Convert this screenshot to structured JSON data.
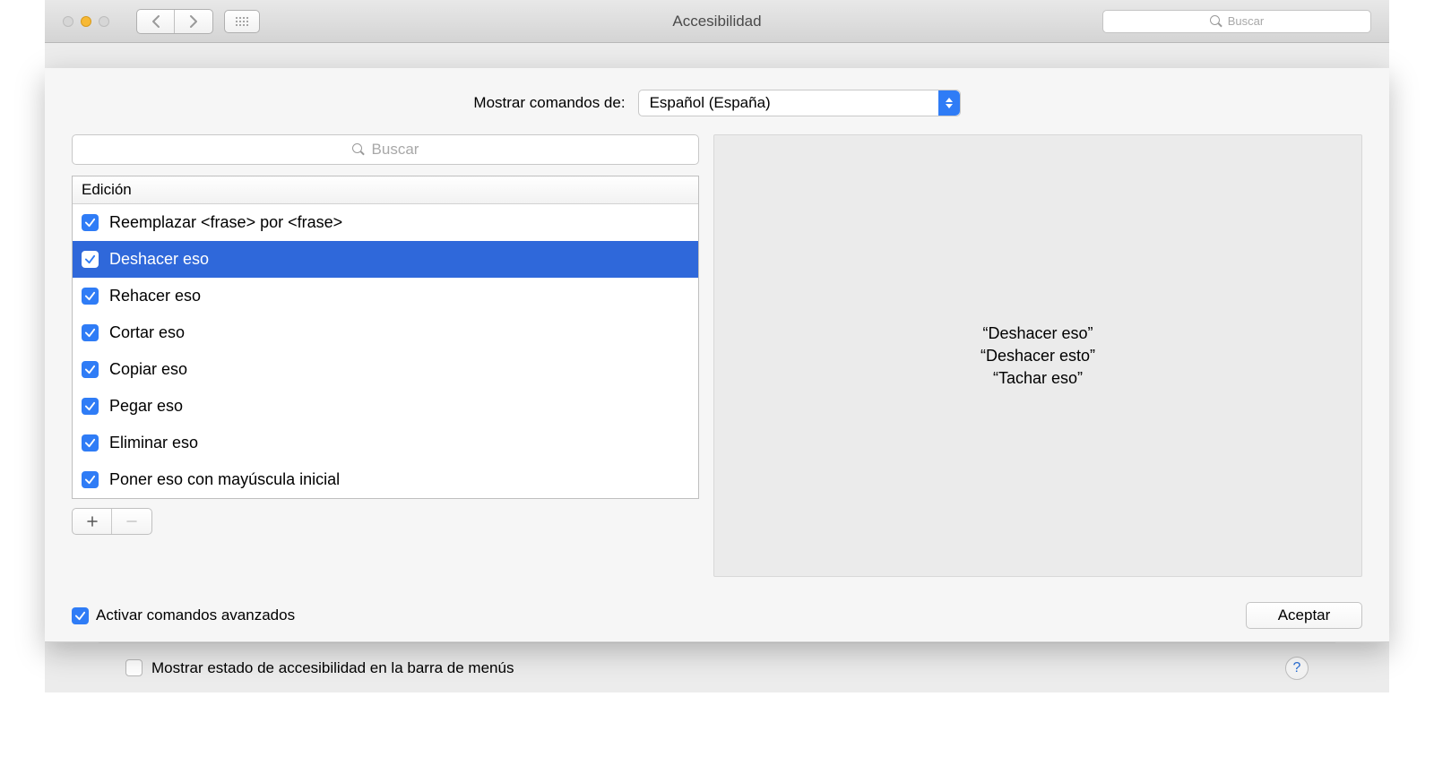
{
  "titlebar": {
    "title": "Accesibilidad",
    "search_placeholder": "Buscar"
  },
  "sheet": {
    "lang_label": "Mostrar comandos de:",
    "lang_value": "Español (España)",
    "search_placeholder": "Buscar",
    "list_header": "Edición",
    "items": [
      {
        "label": "Reemplazar <frase> por <frase>",
        "checked": true,
        "selected": false
      },
      {
        "label": "Deshacer eso",
        "checked": true,
        "selected": true
      },
      {
        "label": "Rehacer eso",
        "checked": true,
        "selected": false
      },
      {
        "label": "Cortar eso",
        "checked": true,
        "selected": false
      },
      {
        "label": "Copiar eso",
        "checked": true,
        "selected": false
      },
      {
        "label": "Pegar eso",
        "checked": true,
        "selected": false
      },
      {
        "label": "Eliminar eso",
        "checked": true,
        "selected": false
      },
      {
        "label": "Poner eso con mayúscula inicial",
        "checked": true,
        "selected": false
      }
    ],
    "detail": {
      "line1": "“Deshacer eso”",
      "line2": "“Deshacer esto”",
      "line3": "“Tachar eso”"
    },
    "advanced_label": "Activar comandos avanzados",
    "accept_label": "Aceptar"
  },
  "background": {
    "status_label": "Mostrar estado de accesibilidad en la barra de menús",
    "help_label": "?"
  }
}
